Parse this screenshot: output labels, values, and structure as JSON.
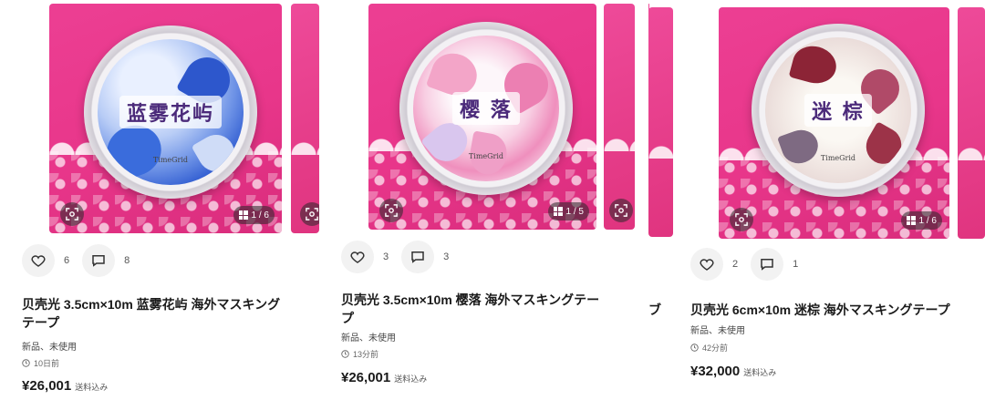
{
  "listings": [
    {
      "tape_title": "蓝雾花屿",
      "tape_brand": "TimeGrid",
      "page_indicator": "1 / 6",
      "likes": "6",
      "comments": "8",
      "title_line1": "贝壳光 3.5cm×10m 蓝雾花屿 海外マスキング",
      "title_line2": "テープ",
      "condition": "新品、未使用",
      "time": "10日前",
      "price": "¥26,001",
      "shipping": "送料込み",
      "accent": "#3b6fd8"
    },
    {
      "tape_title": "樱 落",
      "tape_brand": "TimeGrid",
      "page_indicator": "1 / 5",
      "likes": "3",
      "comments": "3",
      "title_line1": "贝壳光 3.5cm×10m 樱落 海外マスキングテー",
      "title_line2": "プ",
      "condition": "新品、未使用",
      "time": "13分前",
      "price": "¥26,001",
      "shipping": "送料込み",
      "accent": "#e76aa8"
    },
    {
      "tape_title": "迷 棕",
      "tape_brand": "TimeGrid",
      "page_indicator": "1 / 6",
      "likes": "2",
      "comments": "1",
      "title_line1": "贝壳光 6cm×10m 迷棕 海外マスキングテープ",
      "title_line2": "",
      "condition": "新品、未使用",
      "time": "42分前",
      "price": "¥32,000",
      "shipping": "送料込み",
      "accent": "#7a2a3a"
    }
  ],
  "truncated_text": "ブ",
  "icons": {
    "like": "heart-icon",
    "comment": "comment-icon",
    "scan": "scan-icon",
    "gallery": "grid-icon",
    "time": "clock-icon"
  }
}
